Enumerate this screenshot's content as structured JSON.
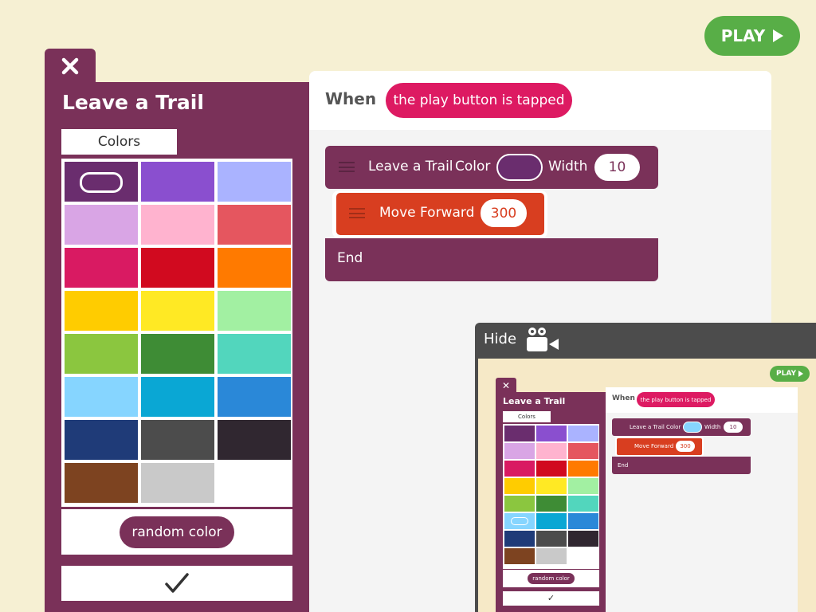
{
  "play_button": {
    "label": "PLAY"
  },
  "panel": {
    "title": "Leave a Trail",
    "tab": "Colors",
    "random_label": "random color",
    "swatches": [
      "#6a2d6e",
      "#8a4fcf",
      "#aab3ff",
      "#d9a5e5",
      "#ffb3cf",
      "#e5565f",
      "#d91a62",
      "#d10a1f",
      "#ff7a00",
      "#ffcc00",
      "#ffe924",
      "#a2f0a2",
      "#8bc63f",
      "#3e8c35",
      "#52d6bd",
      "#86d5ff",
      "#0aa7d4",
      "#2a88d8",
      "#1f3b78",
      "#4c4c4c",
      "#302730",
      "#7d4320",
      "#c9c9c9",
      "#ffffff"
    ],
    "selected_swatch": 0
  },
  "script": {
    "when_label": "When",
    "trigger": "the play button is tapped",
    "trail_block": {
      "label1": "Leave a Trail",
      "label2": "Color",
      "label3": "Width",
      "width_value": "10"
    },
    "move_block": {
      "label": "Move Forward",
      "value": "300"
    },
    "end_label": "End"
  },
  "video": {
    "hide_label": "Hide"
  },
  "preview": {
    "play": "PLAY",
    "title": "Leave a Trail",
    "tab": "Colors",
    "when": "When",
    "trigger": "the play button is tapped",
    "trail": "Leave a Trail",
    "color": "Color",
    "width": "Width",
    "width_value": "10",
    "move": "Move Forward",
    "move_value": "300",
    "end": "End",
    "random": "random color",
    "swatches": [
      "#6a2d6e",
      "#8a4fcf",
      "#aab3ff",
      "#d9a5e5",
      "#ffb3cf",
      "#e5565f",
      "#d91a62",
      "#d10a1f",
      "#ff7a00",
      "#ffcc00",
      "#ffe924",
      "#a2f0a2",
      "#8bc63f",
      "#3e8c35",
      "#52d6bd",
      "#86d5ff",
      "#0aa7d4",
      "#2a88d8",
      "#1f3b78",
      "#4c4c4c",
      "#302730",
      "#7d4320",
      "#c9c9c9",
      "#ffffff"
    ],
    "selected_swatch": 15
  }
}
